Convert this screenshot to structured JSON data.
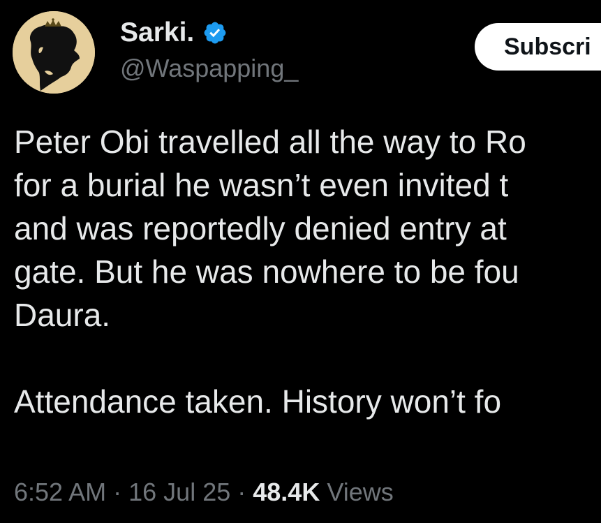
{
  "author": {
    "display_name": "Sarki.",
    "handle": "@Waspapping_",
    "verified": true,
    "avatar_icon": "silhouette-with-crown-avatar"
  },
  "actions": {
    "subscribe_label": "Subscri"
  },
  "tweet": {
    "lines": [
      "Peter Obi travelled all the way to Ro",
      "for a burial he wasn’t even invited t",
      "and was reportedly denied entry at",
      "gate. But he was nowhere to be fou",
      "Daura.",
      "Attendance taken. History won’t fo"
    ]
  },
  "meta": {
    "time": "6:52 AM",
    "separator": "·",
    "date": "16 Jul 25",
    "views_count": "48.4K",
    "views_label": "Views"
  },
  "colors": {
    "background": "#000000",
    "text_primary": "#e7e9ea",
    "text_secondary": "#71767b",
    "verified": "#1d9bf0",
    "button_bg": "#ffffff",
    "avatar_bg": "#e6cf9c"
  }
}
